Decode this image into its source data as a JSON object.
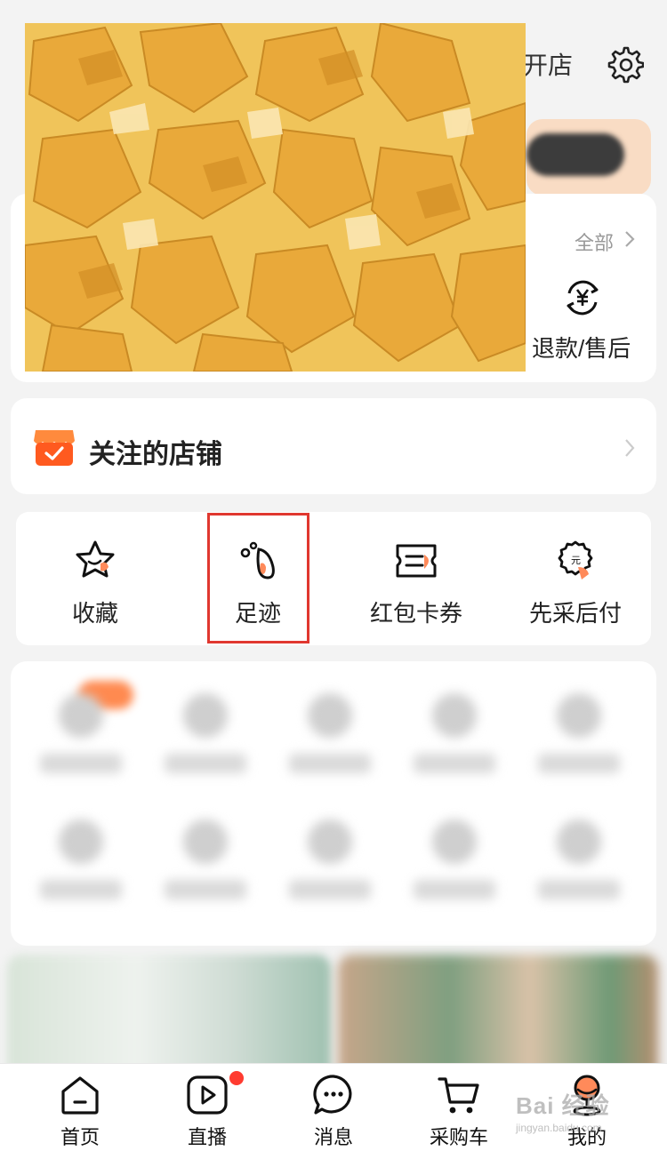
{
  "header": {
    "open_shop_label": "开店",
    "settings_icon": "gear-icon"
  },
  "orders": {
    "all_label": "全部",
    "refund_label": "退款/售后",
    "refund_icon": "yuan-refund-icon"
  },
  "followed_shops": {
    "label": "关注的店铺",
    "icon": "shop-icon"
  },
  "quick_tools": [
    {
      "label": "收藏",
      "icon": "star-icon"
    },
    {
      "label": "足迹",
      "icon": "footprint-icon"
    },
    {
      "label": "红包卡券",
      "icon": "coupon-icon"
    },
    {
      "label": "先采后付",
      "icon": "pay-later-icon"
    }
  ],
  "tab_bar": [
    {
      "label": "首页",
      "icon": "home-icon"
    },
    {
      "label": "直播",
      "icon": "live-icon"
    },
    {
      "label": "消息",
      "icon": "message-icon"
    },
    {
      "label": "采购车",
      "icon": "cart-icon"
    },
    {
      "label": "我的",
      "icon": "profile-icon"
    }
  ],
  "watermark": {
    "text": "Bai 经验",
    "sub": "jingyan.baidu.com"
  },
  "colors": {
    "accent": "#ff5a1f",
    "highlight_border": "#e0372f",
    "card_bg": "#ffffff",
    "page_bg": "#f3f3f3"
  }
}
